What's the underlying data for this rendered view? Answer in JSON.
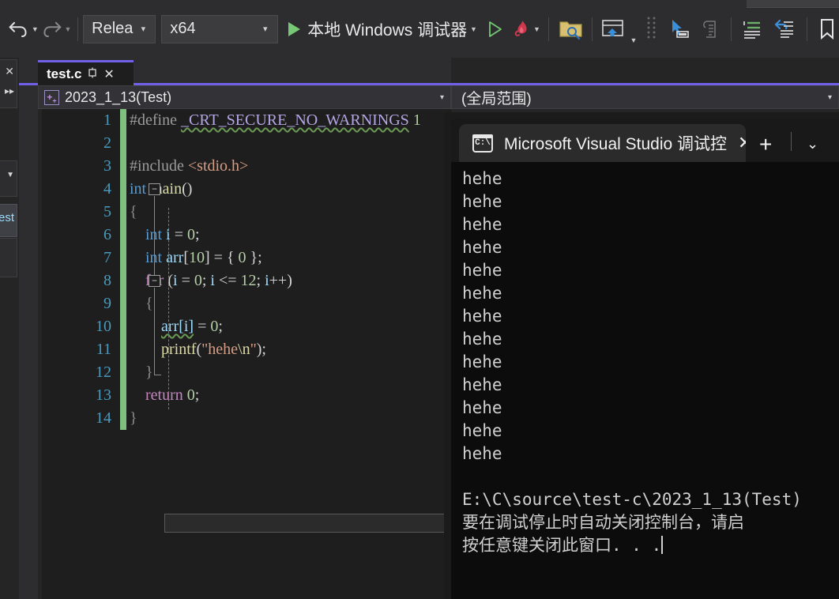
{
  "toolbar": {
    "undo_icon": "undo-icon",
    "redo_icon": "redo-icon",
    "configuration": {
      "value": "Release",
      "arrow": "▾"
    },
    "platform": {
      "value": "x64",
      "arrow": "▾"
    },
    "run_button": {
      "label": "本地 Windows 调试器",
      "arrow": "▾"
    },
    "start_without_debug_icon": "play-outline-icon",
    "hot_reload_icon": "hot-reload-flame-icon",
    "hot_reload_arrow": "▾",
    "icons": [
      "folder-search-icon",
      "home-window-icon",
      "dropdown-small-icon",
      "dots-grid-icon",
      "select-element-icon",
      "compare-file-icon",
      "indent-lines-icon",
      "undo-indent-icon",
      "bookmark-icon"
    ]
  },
  "editor": {
    "tab": {
      "name": "test.c",
      "pin_icon": "pin-icon",
      "close_icon": "close-icon"
    },
    "nav_left": {
      "icon": "member-icon",
      "value": "2023_1_13(Test)",
      "arrow": "▾"
    },
    "nav_right": {
      "value": "(全局范围)",
      "arrow": "▾"
    },
    "line_numbers": [
      1,
      2,
      3,
      4,
      5,
      6,
      7,
      8,
      9,
      10,
      11,
      12,
      13,
      14
    ],
    "lines": [
      {
        "n": 1,
        "changed": true,
        "tokens": [
          {
            "t": "#define ",
            "c": "k-pre"
          },
          {
            "t": "_CRT_SECURE_NO_WARNINGS",
            "c": "k-macro squiggle"
          },
          {
            "t": " 1",
            "c": "k-num"
          }
        ]
      },
      {
        "n": 2,
        "changed": true,
        "tokens": []
      },
      {
        "n": 3,
        "changed": true,
        "tokens": [
          {
            "t": "#include ",
            "c": "k-pre"
          },
          {
            "t": "<stdio.h>",
            "c": "k-hdr"
          }
        ]
      },
      {
        "n": 4,
        "changed": true,
        "tokens": [
          {
            "t": "int",
            "c": "k-type"
          },
          {
            "t": " ",
            "c": "k-punc"
          },
          {
            "t": "main",
            "c": "k-fn"
          },
          {
            "t": "()",
            "c": "k-punc"
          }
        ]
      },
      {
        "n": 5,
        "changed": true,
        "tokens": [
          {
            "t": "{",
            "c": "k-brace"
          }
        ]
      },
      {
        "n": 6,
        "changed": true,
        "tokens": [
          {
            "t": "    ",
            "c": "k-punc"
          },
          {
            "t": "int",
            "c": "k-type"
          },
          {
            "t": " ",
            "c": "k-punc"
          },
          {
            "t": "i",
            "c": "k-id"
          },
          {
            "t": " = ",
            "c": "k-punc"
          },
          {
            "t": "0",
            "c": "k-num"
          },
          {
            "t": ";",
            "c": "k-punc"
          }
        ]
      },
      {
        "n": 7,
        "changed": true,
        "tokens": [
          {
            "t": "    ",
            "c": "k-punc"
          },
          {
            "t": "int",
            "c": "k-type"
          },
          {
            "t": " ",
            "c": "k-punc"
          },
          {
            "t": "arr",
            "c": "k-id"
          },
          {
            "t": "[",
            "c": "k-punc"
          },
          {
            "t": "10",
            "c": "k-num"
          },
          {
            "t": "] = { ",
            "c": "k-punc"
          },
          {
            "t": "0",
            "c": "k-num"
          },
          {
            "t": " };",
            "c": "k-punc"
          }
        ]
      },
      {
        "n": 8,
        "changed": true,
        "tokens": [
          {
            "t": "    ",
            "c": "k-punc"
          },
          {
            "t": "for",
            "c": "k-kw"
          },
          {
            "t": " (",
            "c": "k-punc"
          },
          {
            "t": "i",
            "c": "k-id"
          },
          {
            "t": " = ",
            "c": "k-punc"
          },
          {
            "t": "0",
            "c": "k-num"
          },
          {
            "t": "; ",
            "c": "k-punc"
          },
          {
            "t": "i",
            "c": "k-id"
          },
          {
            "t": " <= ",
            "c": "k-punc"
          },
          {
            "t": "12",
            "c": "k-num"
          },
          {
            "t": "; ",
            "c": "k-punc"
          },
          {
            "t": "i",
            "c": "k-id"
          },
          {
            "t": "++)",
            "c": "k-punc"
          }
        ]
      },
      {
        "n": 9,
        "changed": true,
        "tokens": [
          {
            "t": "    {",
            "c": "k-brace"
          }
        ]
      },
      {
        "n": 10,
        "changed": true,
        "tokens": [
          {
            "t": "        ",
            "c": "k-punc"
          },
          {
            "t": "arr[i]",
            "c": "k-id squiggle"
          },
          {
            "t": " = ",
            "c": "k-punc"
          },
          {
            "t": "0",
            "c": "k-num"
          },
          {
            "t": ";",
            "c": "k-punc"
          }
        ]
      },
      {
        "n": 11,
        "changed": true,
        "tokens": [
          {
            "t": "        ",
            "c": "k-punc"
          },
          {
            "t": "printf",
            "c": "k-fn"
          },
          {
            "t": "(",
            "c": "k-punc"
          },
          {
            "t": "\"hehe",
            "c": "k-str"
          },
          {
            "t": "\\n",
            "c": "k-esc"
          },
          {
            "t": "\"",
            "c": "k-str"
          },
          {
            "t": ");",
            "c": "k-punc"
          }
        ]
      },
      {
        "n": 12,
        "changed": true,
        "tokens": [
          {
            "t": "    }",
            "c": "k-brace"
          }
        ]
      },
      {
        "n": 13,
        "changed": true,
        "tokens": [
          {
            "t": "    ",
            "c": "k-punc"
          },
          {
            "t": "return",
            "c": "k-kw"
          },
          {
            "t": " ",
            "c": "k-punc"
          },
          {
            "t": "0",
            "c": "k-num"
          },
          {
            "t": ";",
            "c": "k-punc"
          }
        ]
      },
      {
        "n": 14,
        "changed": true,
        "tokens": [
          {
            "t": "}",
            "c": "k-brace"
          }
        ]
      }
    ],
    "fold_markers": [
      "minus",
      "minus"
    ],
    "horizontal_scrollbar": "h-scrollbar"
  },
  "console": {
    "tab_title": "Microsoft Visual Studio 调试控",
    "tab_icon": "cmd-console-icon",
    "close_icon": "✕",
    "new_tab_icon": "+",
    "chevron_icon": "⌄",
    "output_lines": [
      "hehe",
      "hehe",
      "hehe",
      "hehe",
      "hehe",
      "hehe",
      "hehe",
      "hehe",
      "hehe",
      "hehe",
      "hehe",
      "hehe",
      "hehe"
    ],
    "footer_lines": [
      "E:\\C\\source\\test-c\\2023_1_13(Test)",
      "要在调试停止时自动关闭控制台，请启",
      "按任意键关闭此窗口. . ."
    ]
  },
  "colors": {
    "accent_purple": "#7160e8",
    "change_bar_green": "#7fbf7f",
    "editor_bg": "#1e1e1e",
    "chrome_bg": "#2d2d30",
    "console_bg": "#0c0c0c",
    "play_green": "#76c776",
    "lineno_blue": "#4a9bbd"
  }
}
